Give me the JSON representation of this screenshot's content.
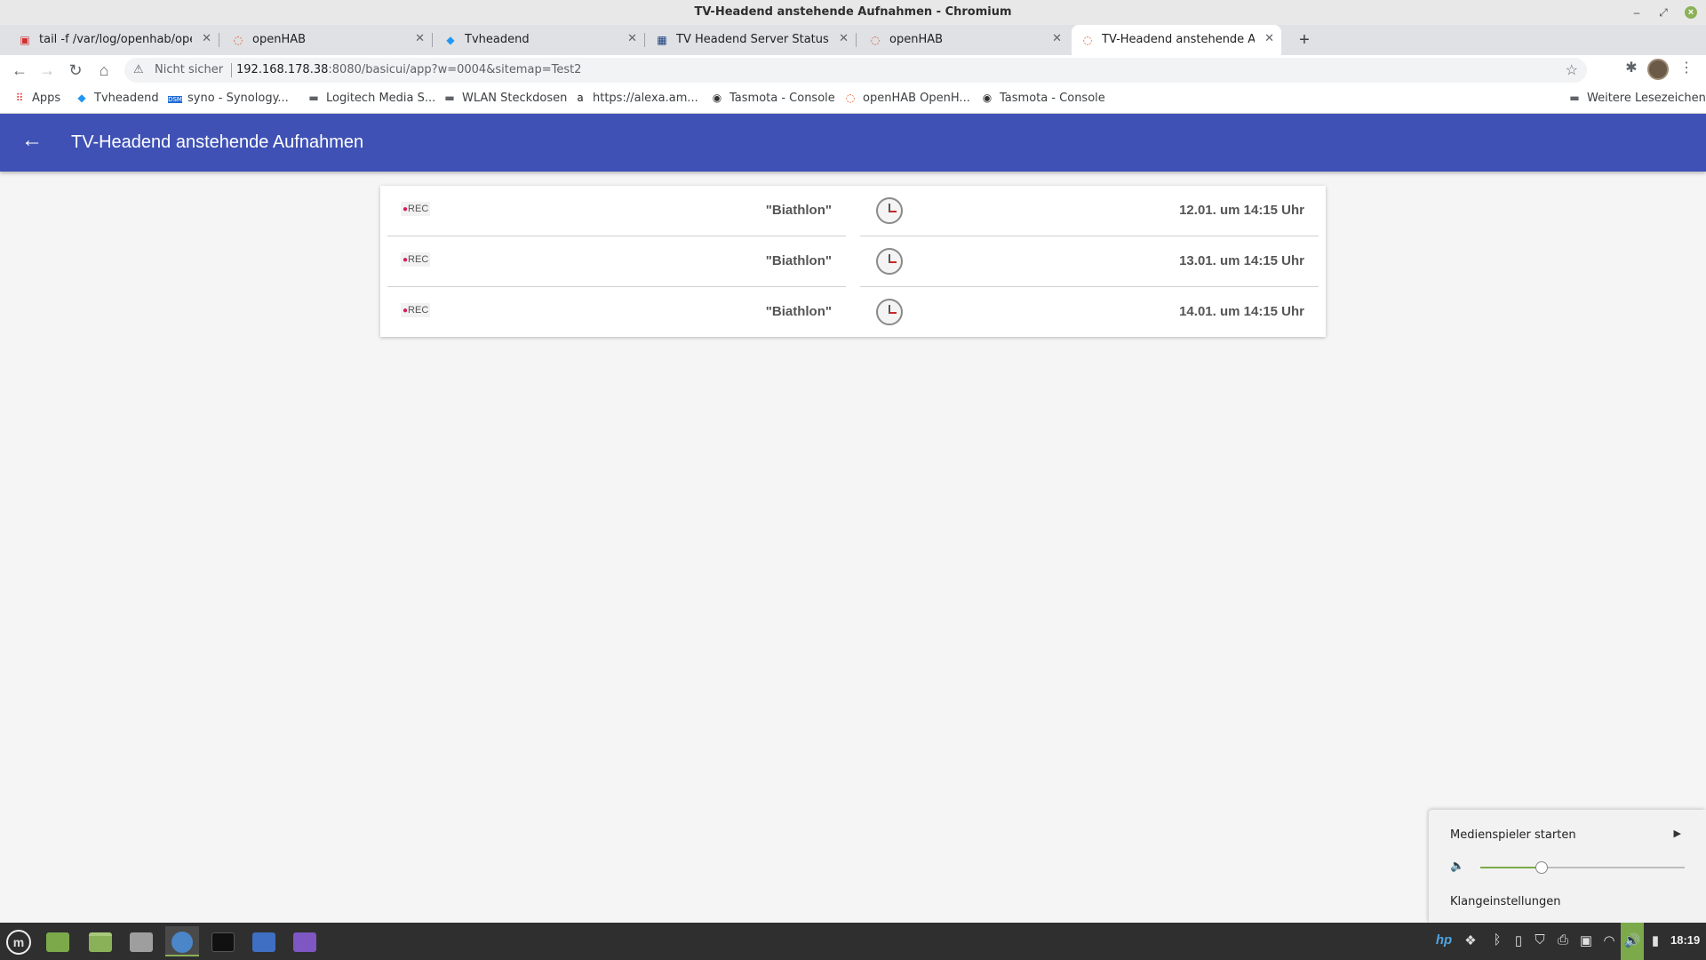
{
  "window": {
    "title": "TV-Headend anstehende Aufnahmen - Chromium"
  },
  "tabs": [
    {
      "label": "tail -f /var/log/openhab/openhab.log",
      "icon": "pdf-icon"
    },
    {
      "label": "openHAB",
      "icon": "openhab-icon"
    },
    {
      "label": "Tvheadend",
      "icon": "tvheadend-icon"
    },
    {
      "label": "TV Headend Server Status in Sitemap",
      "icon": "forum-icon"
    },
    {
      "label": "openHAB",
      "icon": "openhab-icon"
    },
    {
      "label": "TV-Headend anstehende Aufnahmen",
      "icon": "openhab-icon"
    }
  ],
  "address": {
    "security": "Nicht sicher",
    "host": "192.168.178.38",
    "rest": ":8080/basicui/app?w=0004&sitemap=Test2"
  },
  "bookmarks": {
    "items": [
      {
        "label": "Apps",
        "icon": "apps-grid-icon"
      },
      {
        "label": "Tvheadend",
        "icon": "tvheadend-icon"
      },
      {
        "label": "syno - Synology...",
        "icon": "dsm-icon"
      },
      {
        "label": "Logitech Media S...",
        "icon": "folder-icon"
      },
      {
        "label": "WLAN Steckdosen",
        "icon": "folder-icon"
      },
      {
        "label": "https://alexa.am...",
        "icon": "amazon-icon"
      },
      {
        "label": "Tasmota - Console",
        "icon": "tasmota-icon"
      },
      {
        "label": "openHAB OpenH...",
        "icon": "openhab-icon"
      },
      {
        "label": "Tasmota - Console",
        "icon": "tasmota-icon"
      }
    ],
    "more": "Weitere Lesezeichen"
  },
  "app": {
    "title": "TV-Headend anstehende Aufnahmen"
  },
  "recordings": [
    {
      "tag": "REC",
      "title": "\"Biathlon\"",
      "time": "12.01. um 14:15 Uhr"
    },
    {
      "tag": "REC",
      "title": "\"Biathlon\"",
      "time": "13.01. um 14:15 Uhr"
    },
    {
      "tag": "REC",
      "title": "\"Biathlon\"",
      "time": "14.01. um 14:15 Uhr"
    }
  ],
  "sound_popup": {
    "media_player": "Medienspieler starten",
    "settings": "Klangeinstellungen",
    "volume_level": 0.3
  },
  "taskbar": {
    "clock": "18:19"
  },
  "colors": {
    "header": "#3f51b5",
    "rec_dot": "#d81b60",
    "accent_green": "#7ca94a"
  }
}
